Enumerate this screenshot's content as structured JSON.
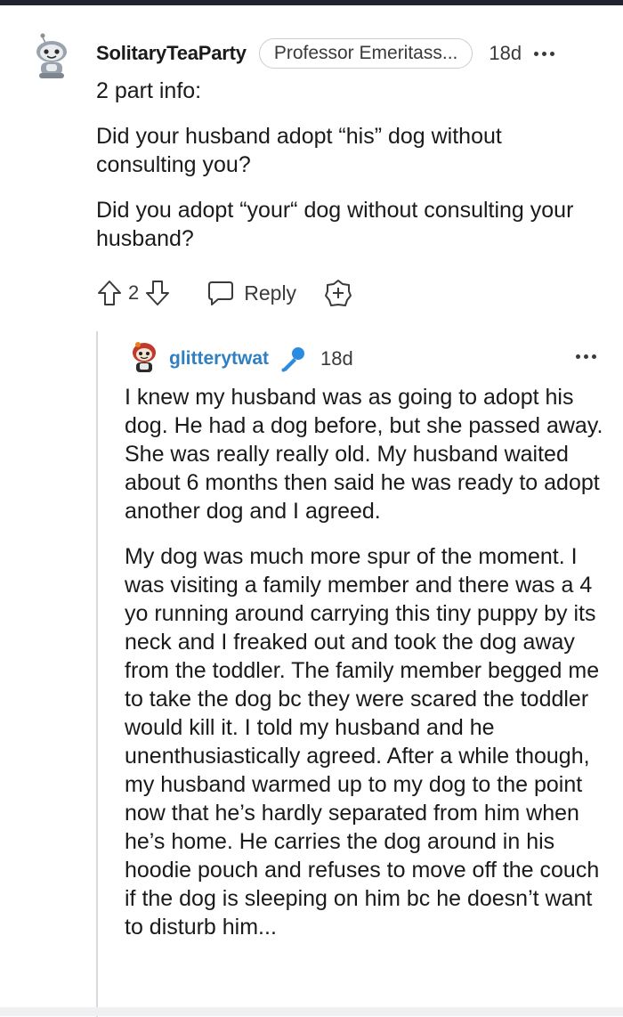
{
  "comment1": {
    "username": "SolitaryTeaParty",
    "flair": "Professor Emeritass...",
    "time": "18d",
    "paragraphs": [
      "2 part info:",
      "Did your husband adopt “his” dog without consulting you?",
      "Did you adopt “your“ dog without consulting your husband?"
    ],
    "vote_count": "2",
    "reply_label": "Reply"
  },
  "comment2": {
    "username": "glitterytwat",
    "time": "18d",
    "paragraphs": [
      "I knew my husband was as going to adopt his dog. He had a dog before, but she passed away. She was really really old. My husband waited about 6 months then said he was ready to adopt another dog and I agreed.",
      "My dog was much more spur of the moment. I was visiting a family member and there was a 4 yo running around carrying this tiny puppy by its neck and I freaked out and took the dog away from the toddler. The family member begged me to take the dog bc they were scared the toddler would kill it. I told my husband and he unenthusiastically agreed. After a while though, my husband warmed up to my dog to the point now that he’s hardly separated from him when he’s home. He carries the dog around in his hoodie pouch and refuses to move off the couch if the dog is sleeping on him bc he doesn’t want to disturb him..."
    ]
  },
  "icons": {
    "avatar1": "snoo-avatar-icon",
    "avatar2": "snoo-avatar-icon",
    "upvote": "upvote-arrow-icon",
    "downvote": "downvote-arrow-icon",
    "reply": "speech-bubble-icon",
    "award": "award-plus-icon",
    "mic": "microphone-icon",
    "more": "more-options-icon"
  },
  "colors": {
    "username2": "#2f7fc1",
    "topbar": "#1f2430",
    "thread_line": "#d7d9dc"
  }
}
